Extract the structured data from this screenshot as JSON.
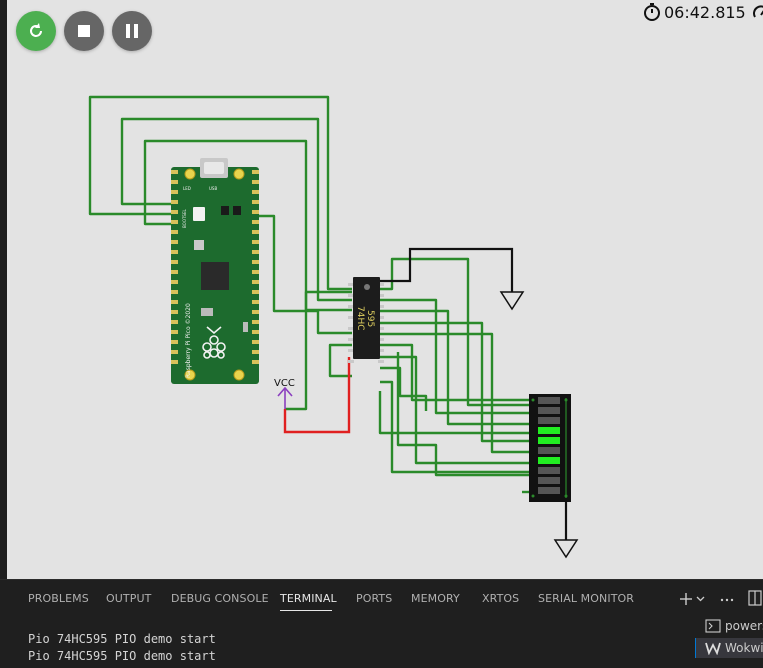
{
  "controls": {
    "restart_icon": "restart-icon",
    "stop_icon": "stop-icon",
    "pause_icon": "pause-icon",
    "restart_color": "#4caf50",
    "stop_color": "#666666",
    "pause_color": "#666666"
  },
  "timer": {
    "elapsed": "06:42.815",
    "icon": "stopwatch-icon",
    "speed_icon": "speedometer-icon"
  },
  "circuit": {
    "chip_label_1": "74HC",
    "chip_label_2": "595",
    "vcc_label": "VCC",
    "pico_small_labels": [
      "LED",
      "USB",
      "BOOTSEL"
    ],
    "pico_side_text": "Raspberry Pi Pico ©2020",
    "led_states": [
      false,
      false,
      false,
      true,
      true,
      false,
      true,
      false,
      false,
      false
    ],
    "wire_color": "#2a8a2a",
    "power_wire_color": "#e02020",
    "ground_wire_color": "#111111",
    "led_on_color": "#22ee22",
    "led_off_color": "#555555"
  },
  "panel": {
    "tabs": [
      "PROBLEMS",
      "OUTPUT",
      "DEBUG CONSOLE",
      "TERMINAL",
      "PORTS",
      "MEMORY",
      "XRTOS",
      "SERIAL MONITOR"
    ],
    "active_tab": "TERMINAL",
    "terminal_lines": [
      "Pio 74HC595 PIO demo start",
      "Pio 74HC595 PIO demo start"
    ],
    "side_items": [
      "powershell",
      "Wokwi"
    ],
    "icons": [
      "plus-icon",
      "chevron-down-icon",
      "more-icon",
      "split-icon"
    ]
  }
}
